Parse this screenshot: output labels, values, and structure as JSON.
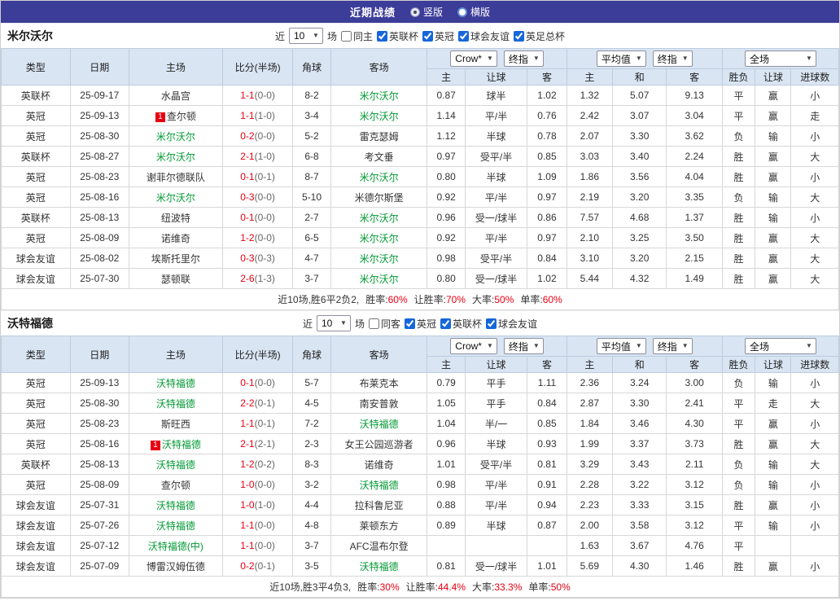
{
  "topbar": {
    "title": "近期战绩",
    "vertical_label": "竖版",
    "horizontal_label": "横版"
  },
  "columns": {
    "type": "类型",
    "date": "日期",
    "home": "主场",
    "score": "比分(半场)",
    "corner": "角球",
    "away": "客场",
    "asia_home": "主",
    "asia_line": "让球",
    "asia_away": "客",
    "euro_home": "主",
    "euro_draw": "和",
    "euro_away": "客",
    "result": "胜负",
    "handicap": "让球",
    "goals": "进球数"
  },
  "dropdowns": {
    "asia_source": "Crow*",
    "asia_mode": "终指",
    "euro_source": "平均值",
    "euro_mode": "终指",
    "goals_scope": "全场"
  },
  "sections": [
    {
      "team": "米尔沃尔",
      "near_label": "近",
      "games": "10",
      "games_suffix": "场",
      "same_label": "同主",
      "leagues": [
        "英联杯",
        "英冠",
        "球会友谊",
        "英足总杯"
      ],
      "rows": [
        {
          "type": "英联杯",
          "date": "25-09-17",
          "home": "水晶宫",
          "score": "1-1",
          "half": "(0-0)",
          "corner": "8-2",
          "away": "米尔沃尔",
          "away_focus": true,
          "ah_home": "0.87",
          "ah_line": "球半",
          "ah_away": "1.02",
          "eu_home": "1.32",
          "eu_draw": "5.07",
          "eu_away": "9.13",
          "result": "平",
          "hc": "赢",
          "goal": "小"
        },
        {
          "type": "英冠",
          "date": "25-09-13",
          "home": "查尔顿",
          "home_red": "1",
          "score": "1-1",
          "half": "(1-0)",
          "corner": "3-4",
          "away": "米尔沃尔",
          "away_focus": true,
          "ah_home": "1.14",
          "ah_line": "平/半",
          "ah_away": "0.76",
          "eu_home": "2.42",
          "eu_draw": "3.07",
          "eu_away": "3.04",
          "result": "平",
          "hc": "赢",
          "goal": "走"
        },
        {
          "type": "英冠",
          "date": "25-08-30",
          "home": "米尔沃尔",
          "home_focus": true,
          "score": "0-2",
          "half": "(0-0)",
          "corner": "5-2",
          "away": "雷克瑟姆",
          "ah_home": "1.12",
          "ah_line": "半球",
          "ah_away": "0.78",
          "eu_home": "2.07",
          "eu_draw": "3.30",
          "eu_away": "3.62",
          "result": "负",
          "hc": "输",
          "goal": "小"
        },
        {
          "type": "英联杯",
          "date": "25-08-27",
          "home": "米尔沃尔",
          "home_focus": true,
          "score": "2-1",
          "half": "(1-0)",
          "corner": "6-8",
          "away": "考文垂",
          "ah_home": "0.97",
          "ah_line": "受平/半",
          "ah_away": "0.85",
          "eu_home": "3.03",
          "eu_draw": "3.40",
          "eu_away": "2.24",
          "result": "胜",
          "hc": "赢",
          "goal": "大"
        },
        {
          "type": "英冠",
          "date": "25-08-23",
          "home": "谢菲尔德联队",
          "score": "0-1",
          "half": "(0-1)",
          "corner": "8-7",
          "away": "米尔沃尔",
          "away_focus": true,
          "ah_home": "0.80",
          "ah_line": "半球",
          "ah_away": "1.09",
          "eu_home": "1.86",
          "eu_draw": "3.56",
          "eu_away": "4.04",
          "result": "胜",
          "hc": "赢",
          "goal": "小"
        },
        {
          "type": "英冠",
          "date": "25-08-16",
          "home": "米尔沃尔",
          "home_focus": true,
          "score": "0-3",
          "half": "(0-0)",
          "corner": "5-10",
          "away": "米德尔斯堡",
          "ah_home": "0.92",
          "ah_line": "平/半",
          "ah_away": "0.97",
          "eu_home": "2.19",
          "eu_draw": "3.20",
          "eu_away": "3.35",
          "result": "负",
          "hc": "输",
          "goal": "大"
        },
        {
          "type": "英联杯",
          "date": "25-08-13",
          "home": "纽波特",
          "score": "0-1",
          "half": "(0-0)",
          "corner": "2-7",
          "away": "米尔沃尔",
          "away_focus": true,
          "ah_home": "0.96",
          "ah_line": "受一/球半",
          "ah_away": "0.86",
          "eu_home": "7.57",
          "eu_draw": "4.68",
          "eu_away": "1.37",
          "result": "胜",
          "hc": "输",
          "goal": "小"
        },
        {
          "type": "英冠",
          "date": "25-08-09",
          "home": "诺维奇",
          "score": "1-2",
          "half": "(0-0)",
          "corner": "6-5",
          "away": "米尔沃尔",
          "away_focus": true,
          "ah_home": "0.92",
          "ah_line": "平/半",
          "ah_away": "0.97",
          "eu_home": "2.10",
          "eu_draw": "3.25",
          "eu_away": "3.50",
          "result": "胜",
          "hc": "赢",
          "goal": "大"
        },
        {
          "type": "球会友谊",
          "date": "25-08-02",
          "home": "埃斯托里尔",
          "score": "0-3",
          "half": "(0-3)",
          "corner": "4-7",
          "away": "米尔沃尔",
          "away_focus": true,
          "ah_home": "0.98",
          "ah_line": "受平/半",
          "ah_away": "0.84",
          "eu_home": "3.10",
          "eu_draw": "3.20",
          "eu_away": "2.15",
          "result": "胜",
          "hc": "赢",
          "goal": "大"
        },
        {
          "type": "球会友谊",
          "date": "25-07-30",
          "home": "瑟顿联",
          "score": "2-6",
          "half": "(1-3)",
          "corner": "3-7",
          "away": "米尔沃尔",
          "away_focus": true,
          "ah_home": "0.80",
          "ah_line": "受一/球半",
          "ah_away": "1.02",
          "eu_home": "5.44",
          "eu_draw": "4.32",
          "eu_away": "1.49",
          "result": "胜",
          "hc": "赢",
          "goal": "大"
        }
      ],
      "summary": {
        "record": "近10场,胜6平2负2,",
        "rate_label": "胜率:",
        "rate": "60%",
        "hc_label": "让胜率:",
        "hc_rate": "70%",
        "big_label": "大率:",
        "big_rate": "50%",
        "single_label": "单率:",
        "single_rate": "60%"
      }
    },
    {
      "team": "沃特福德",
      "near_label": "近",
      "games": "10",
      "games_suffix": "场",
      "same_label": "同客",
      "leagues": [
        "英冠",
        "英联杯",
        "球会友谊"
      ],
      "rows": [
        {
          "type": "英冠",
          "date": "25-09-13",
          "home": "沃特福德",
          "home_focus": true,
          "score": "0-1",
          "half": "(0-0)",
          "corner": "5-7",
          "away": "布莱克本",
          "ah_home": "0.79",
          "ah_line": "平手",
          "ah_away": "1.11",
          "eu_home": "2.36",
          "eu_draw": "3.24",
          "eu_away": "3.00",
          "result": "负",
          "hc": "输",
          "goal": "小"
        },
        {
          "type": "英冠",
          "date": "25-08-30",
          "home": "沃特福德",
          "home_focus": true,
          "score": "2-2",
          "half": "(0-1)",
          "corner": "4-5",
          "away": "南安普敦",
          "ah_home": "1.05",
          "ah_line": "平手",
          "ah_away": "0.84",
          "eu_home": "2.87",
          "eu_draw": "3.30",
          "eu_away": "2.41",
          "result": "平",
          "hc": "走",
          "goal": "大"
        },
        {
          "type": "英冠",
          "date": "25-08-23",
          "home": "斯旺西",
          "score": "1-1",
          "half": "(0-1)",
          "corner": "7-2",
          "away": "沃特福德",
          "away_focus": true,
          "ah_home": "1.04",
          "ah_line": "半/一",
          "ah_away": "0.85",
          "eu_home": "1.84",
          "eu_draw": "3.46",
          "eu_away": "4.30",
          "result": "平",
          "hc": "赢",
          "goal": "小"
        },
        {
          "type": "英冠",
          "date": "25-08-16",
          "home": "沃特福德",
          "home_red": "1",
          "home_focus": true,
          "score": "2-1",
          "half": "(2-1)",
          "corner": "2-3",
          "away": "女王公园巡游者",
          "ah_home": "0.96",
          "ah_line": "半球",
          "ah_away": "0.93",
          "eu_home": "1.99",
          "eu_draw": "3.37",
          "eu_away": "3.73",
          "result": "胜",
          "hc": "赢",
          "goal": "大"
        },
        {
          "type": "英联杯",
          "date": "25-08-13",
          "home": "沃特福德",
          "home_focus": true,
          "score": "1-2",
          "half": "(0-2)",
          "corner": "8-3",
          "away": "诺维奇",
          "ah_home": "1.01",
          "ah_line": "受平/半",
          "ah_away": "0.81",
          "eu_home": "3.29",
          "eu_draw": "3.43",
          "eu_away": "2.11",
          "result": "负",
          "hc": "输",
          "goal": "大"
        },
        {
          "type": "英冠",
          "date": "25-08-09",
          "home": "查尔顿",
          "score": "1-0",
          "half": "(0-0)",
          "corner": "3-2",
          "away": "沃特福德",
          "away_focus": true,
          "ah_home": "0.98",
          "ah_line": "平/半",
          "ah_away": "0.91",
          "eu_home": "2.28",
          "eu_draw": "3.22",
          "eu_away": "3.12",
          "result": "负",
          "hc": "输",
          "goal": "小"
        },
        {
          "type": "球会友谊",
          "date": "25-07-31",
          "home": "沃特福德",
          "home_focus": true,
          "score": "1-0",
          "half": "(1-0)",
          "corner": "4-4",
          "away": "拉科鲁尼亚",
          "ah_home": "0.88",
          "ah_line": "平/半",
          "ah_away": "0.94",
          "eu_home": "2.23",
          "eu_draw": "3.33",
          "eu_away": "3.15",
          "result": "胜",
          "hc": "赢",
          "goal": "小"
        },
        {
          "type": "球会友谊",
          "date": "25-07-26",
          "home": "沃特福德",
          "home_focus": true,
          "score": "1-1",
          "half": "(0-0)",
          "corner": "4-8",
          "away": "莱顿东方",
          "ah_home": "0.89",
          "ah_line": "半球",
          "ah_away": "0.87",
          "eu_home": "2.00",
          "eu_draw": "3.58",
          "eu_away": "3.12",
          "result": "平",
          "hc": "输",
          "goal": "小"
        },
        {
          "type": "球会友谊",
          "date": "25-07-12",
          "home": "沃特福德(中)",
          "home_focus": true,
          "score": "1-1",
          "half": "(0-0)",
          "corner": "3-7",
          "away": "AFC温布尔登",
          "ah_home": "",
          "ah_line": "",
          "ah_away": "",
          "eu_home": "1.63",
          "eu_draw": "3.67",
          "eu_away": "4.76",
          "result": "平",
          "hc": "",
          "goal": ""
        },
        {
          "type": "球会友谊",
          "date": "25-07-09",
          "home": "博雷汉姆伍德",
          "score": "0-2",
          "half": "(0-1)",
          "corner": "3-5",
          "away": "沃特福德",
          "away_focus": true,
          "ah_home": "0.81",
          "ah_line": "受一/球半",
          "ah_away": "1.01",
          "eu_home": "5.69",
          "eu_draw": "4.30",
          "eu_away": "1.46",
          "result": "胜",
          "hc": "赢",
          "goal": "小"
        }
      ],
      "summary": {
        "record": "近10场,胜3平4负3,",
        "rate_label": "胜率:",
        "rate": "30%",
        "hc_label": "让胜率:",
        "hc_rate": "44.4%",
        "big_label": "大率:",
        "big_rate": "33.3%",
        "single_label": "单率:",
        "single_rate": "50%"
      }
    }
  ]
}
